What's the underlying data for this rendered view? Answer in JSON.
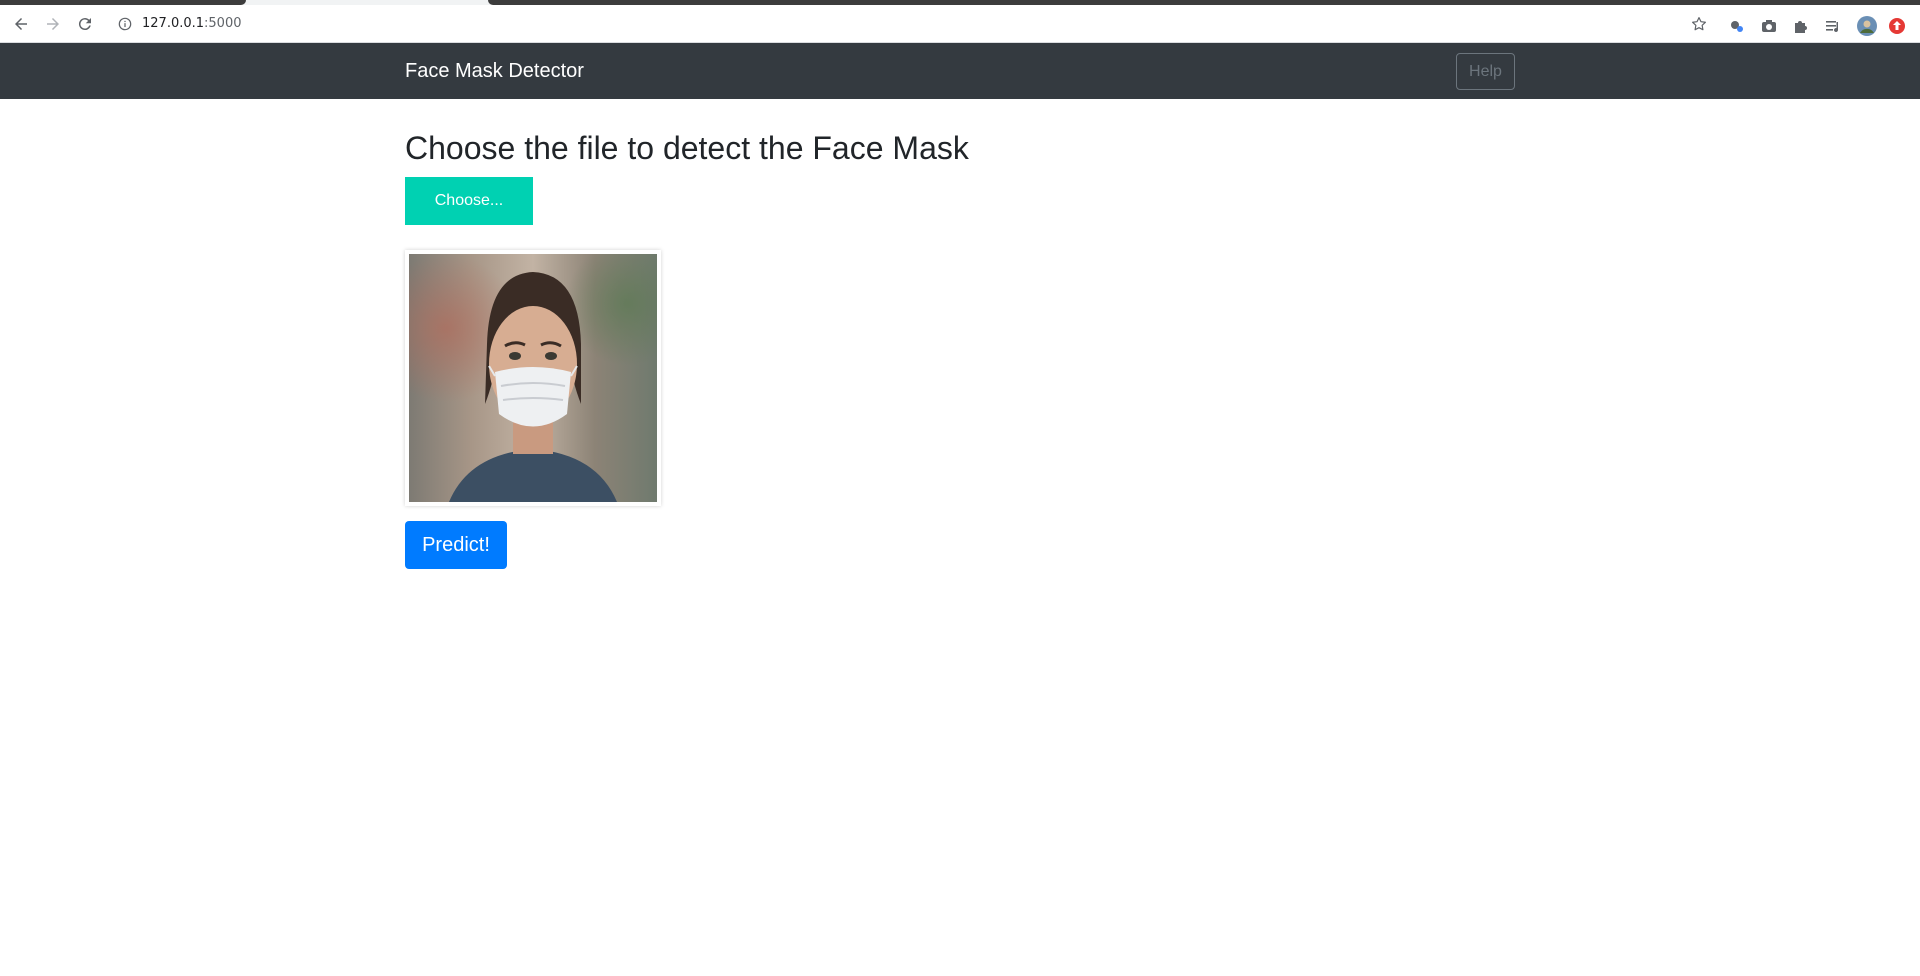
{
  "browser": {
    "url_host": "127.0.0.1",
    "url_port": ":5000",
    "icons": [
      "back-icon",
      "forward-icon",
      "reload-icon",
      "info-icon",
      "bookmark-star-icon",
      "extension-icon",
      "camera-icon",
      "puzzle-icon",
      "reading-list-icon",
      "profile-avatar",
      "extension-red-icon"
    ]
  },
  "navbar": {
    "brand": "Face Mask Detector",
    "help_label": "Help",
    "background": "#343a40"
  },
  "main": {
    "heading": "Choose the file to detect the Face Mask",
    "choose_label": "Choose...",
    "choose_color": "#00d1b2",
    "predict_label": "Predict!",
    "predict_color": "#007bff"
  }
}
